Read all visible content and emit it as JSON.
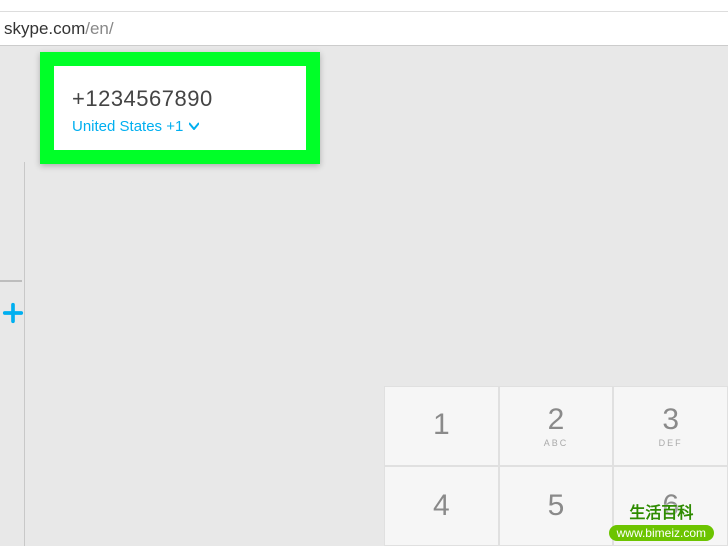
{
  "browser": {
    "url_domain": "skype.com",
    "url_path": "/en/"
  },
  "dialer": {
    "entered_number": "+1234567890",
    "country_label": "United States +1"
  },
  "dialpad": {
    "keys": [
      {
        "digit": "1",
        "letters": ""
      },
      {
        "digit": "2",
        "letters": "ABC"
      },
      {
        "digit": "3",
        "letters": "DEF"
      },
      {
        "digit": "4",
        "letters": ""
      },
      {
        "digit": "5",
        "letters": ""
      },
      {
        "digit": "6",
        "letters": ""
      }
    ]
  },
  "watermark": {
    "text": "生活百科",
    "url": "www.bimeiz.com"
  }
}
